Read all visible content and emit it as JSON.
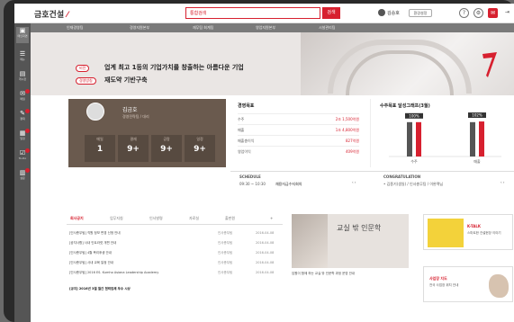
{
  "header": {
    "logo_text": "금호건설",
    "search_scope": "통합검색",
    "search_button": "검색",
    "user_name": "김승호",
    "user_button": "환경설정"
  },
  "sidebar": {
    "items": [
      {
        "label": "메인화면",
        "icon": "home-icon"
      },
      {
        "label": "메뉴",
        "icon": "menu-icon"
      },
      {
        "label": "게시판",
        "icon": "board-icon"
      },
      {
        "label": "메일",
        "icon": "mail-icon"
      },
      {
        "label": "결재",
        "icon": "approval-icon"
      },
      {
        "label": "일정",
        "icon": "calendar-icon"
      },
      {
        "label": "To-Do",
        "icon": "todo-icon"
      },
      {
        "label": "설문",
        "icon": "survey-icon"
      }
    ]
  },
  "tabs": [
    "인재경영팀",
    "경영지원본부",
    "재무팀 회계팀",
    "영업지원본부",
    "시설관리팀"
  ],
  "hero": {
    "vision_pill": "비전",
    "vision_text": "업계 최고 1등의 기업가치를 창출하는 아름다운 기업",
    "policy_pill": "경영방침",
    "policy_text": "재도약 기반구축"
  },
  "profile": {
    "name": "김금호",
    "role": "경영전략팀 / 대리",
    "stats": [
      {
        "label": "메일",
        "value": "1"
      },
      {
        "label": "결재",
        "value": "9+"
      },
      {
        "label": "공람",
        "value": "9+"
      },
      {
        "label": "일정",
        "value": "9+"
      }
    ]
  },
  "kpi": {
    "title": "경영목표",
    "rows": [
      {
        "label": "수주",
        "value": "2조 1,500억원"
      },
      {
        "label": "매출",
        "value": "1조 4,800억원"
      },
      {
        "label": "매출총이익",
        "value": "827억원"
      },
      {
        "label": "영업이익",
        "value": "409억원"
      }
    ]
  },
  "chart_data": {
    "type": "bar",
    "title": "수주목표 달성그래프(3월)",
    "categories": [
      "수주",
      "매출"
    ],
    "series": [
      {
        "values": [
          100,
          100
        ],
        "color": "#555555"
      },
      {
        "values": [
          100,
          102
        ],
        "color": "#d7202f"
      }
    ],
    "data_labels": [
      "100%",
      "102%"
    ]
  },
  "schedule": {
    "heading": "SCHEDULE",
    "time": "09:30 ~ 10:30",
    "event": "채용자금수지회의",
    "congrats_heading": "CONGRATULATION",
    "congrats_text": "• 김종기(생일) / 인사총무팀 / 이완택님"
  },
  "board": {
    "tabs": [
      "회사공지",
      "업무지침",
      "인사발령",
      "자료실",
      "출판원"
    ],
    "rows": [
      {
        "title": "[인사총무팀] 직원 정보 변경 신청 안내",
        "author": "인사총무팀",
        "date": "2016-04-08"
      },
      {
        "title": "[공지사항] 사내 인트라넷 개편 안내",
        "author": "인사총무팀",
        "date": "2016-04-08"
      },
      {
        "title": "[인사총무팀] 4월 복리후생 안내",
        "author": "인사총무팀",
        "date": "2016-04-08"
      },
      {
        "title": "[인사총무팀] 사내 교육 일정 안내",
        "author": "인사총무팀",
        "date": "2016-04-08"
      },
      {
        "title": "[인사총무팀] 2016 ES. Kumho Asiana Leadership Academy",
        "author": "인사총무팀",
        "date": "2016-04-08"
      }
    ],
    "footnote": "[공지] 2016년 3월 월간 협력업체 우수 시상"
  },
  "banner": {
    "title": "교실 밖 인문학",
    "caption": "임원이 함께 하는 교실 밖 인문학 과정 운영 안내"
  },
  "cards": [
    {
      "title": "K-TALK",
      "subtitle": "스마트한 건설현장 이야기"
    },
    {
      "title": "사업장 지도",
      "subtitle": "전국 사업장 위치 안내"
    }
  ]
}
